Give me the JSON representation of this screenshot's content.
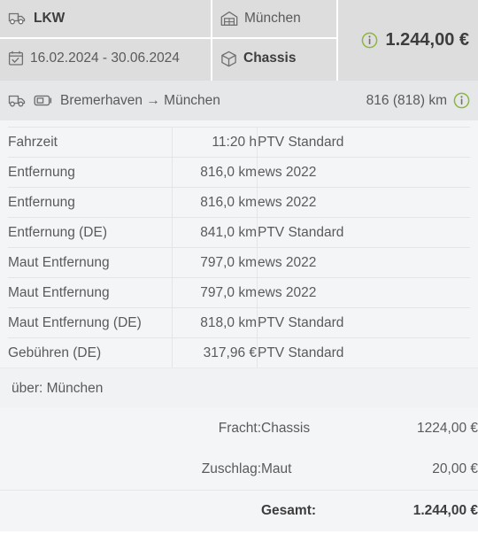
{
  "header": {
    "vehicle": {
      "icon": "truck-icon",
      "label": "LKW"
    },
    "date_range": {
      "icon": "calendar-check-icon",
      "label": "16.02.2024 - 30.06.2024"
    },
    "location": {
      "icon": "warehouse-icon",
      "label": "München"
    },
    "cargo": {
      "icon": "cube-icon",
      "label": "Chassis"
    },
    "price": {
      "icon": "info-icon",
      "value": "1.244,00 €"
    }
  },
  "route": {
    "vehicle_icon": "truck-icon",
    "trailer_icon": "container-icon",
    "origin": "Bremerhaven",
    "arrow": "→",
    "destination": "München",
    "text": "Bremerhaven → München",
    "distance": "816 (818) km",
    "info_icon": "info-icon"
  },
  "details": {
    "rows": [
      {
        "name": "Fahrzeit",
        "value": "11:20 h",
        "source": "PTV Standard"
      },
      {
        "name": "Entfernung",
        "value": "816,0 km",
        "source": "ews 2022"
      },
      {
        "name": "Entfernung",
        "value": "816,0 km",
        "source": "ews 2022"
      },
      {
        "name": "Entfernung (DE)",
        "value": "841,0 km",
        "source": "PTV Standard"
      },
      {
        "name": "Maut Entfernung",
        "value": "797,0 km",
        "source": "ews 2022"
      },
      {
        "name": "Maut Entfernung",
        "value": "797,0 km",
        "source": "ews 2022"
      },
      {
        "name": "Maut Entfernung (DE)",
        "value": "818,0 km",
        "source": "PTV Standard"
      },
      {
        "name": "Gebühren (DE)",
        "value": "317,96 €",
        "source": "PTV Standard"
      }
    ]
  },
  "via": {
    "text": "über: München"
  },
  "costs": {
    "rows": [
      {
        "label": "Fracht:",
        "kind": "Chassis",
        "amount": "1224,00 €"
      },
      {
        "label": "Zuschlag:",
        "kind": "Maut",
        "amount": "20,00 €"
      }
    ],
    "total": {
      "label": "Gesamt:",
      "kind": "",
      "amount": "1.244,00 €"
    }
  },
  "colors": {
    "header_bg": "#dddddd",
    "route_bg": "#e6e7e8",
    "table_bg": "#f4f5f7",
    "icon_stroke": "#6f6f6f",
    "info_green": "#8cb63c",
    "text": "#5a5a5a",
    "text_strong": "#3d3d3d"
  }
}
